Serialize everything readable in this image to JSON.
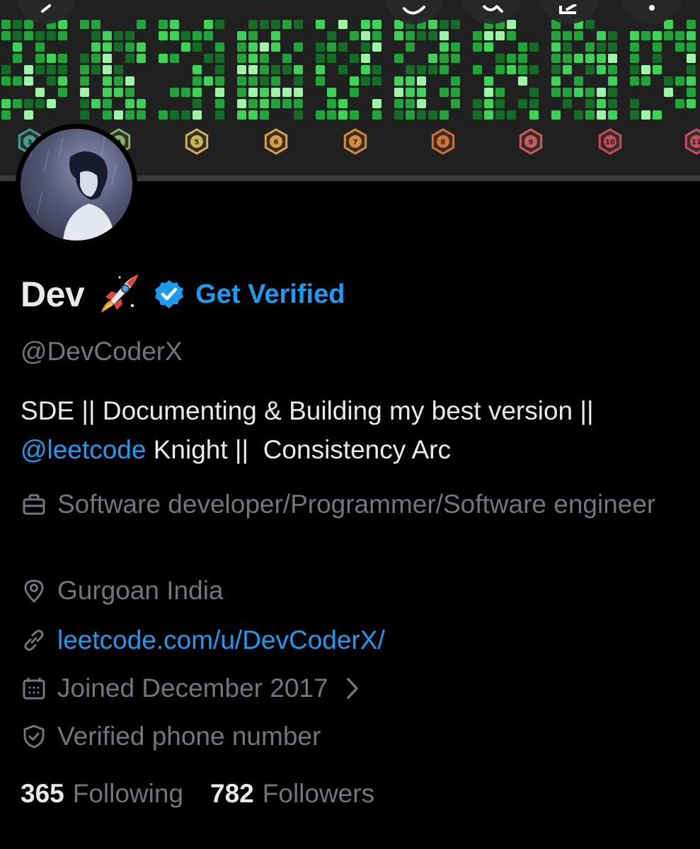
{
  "profile": {
    "display_name": "Dev",
    "get_verified_label": "Get Verified",
    "handle": "@DevCoderX",
    "bio": {
      "line1": "SDE || Documenting & Building my best version ||",
      "mention": "@leetcode",
      "line2_rest": " Knight ||  Consistency Arc"
    },
    "job": "Software developer/Programmer/Software engineer",
    "location": "Gurgoan India",
    "website": "leetcode.com/u/DevCoderX/",
    "joined": "Joined December 2017",
    "verification": "Verified phone number"
  },
  "stats": {
    "following_count": "365",
    "following_label": "Following",
    "followers_count": "782",
    "followers_label": "Followers"
  },
  "banner": {
    "badges": [
      "3",
      "4",
      "5",
      "6",
      "7",
      "8",
      "9",
      "10",
      "11"
    ],
    "badge_colors": [
      "#3aa39a",
      "#7fb06a",
      "#c9b45a",
      "#d7a24b",
      "#d38d3a",
      "#d2713a",
      "#c95a63",
      "#c84b63",
      "#c0506b"
    ]
  },
  "nav": {
    "icons": [
      "back-arrow-icon",
      "sync-icon",
      "search-icon",
      "edit-icon",
      "more-options-icon"
    ]
  },
  "colors": {
    "background": "#000000",
    "accent": "#1d9bf0",
    "primary_text": "#e7e9ea",
    "secondary_text": "#71767b",
    "heatmap_colors": [
      "#166b29",
      "#22a33b",
      "#3fd15a",
      "#9ef2aa"
    ]
  }
}
